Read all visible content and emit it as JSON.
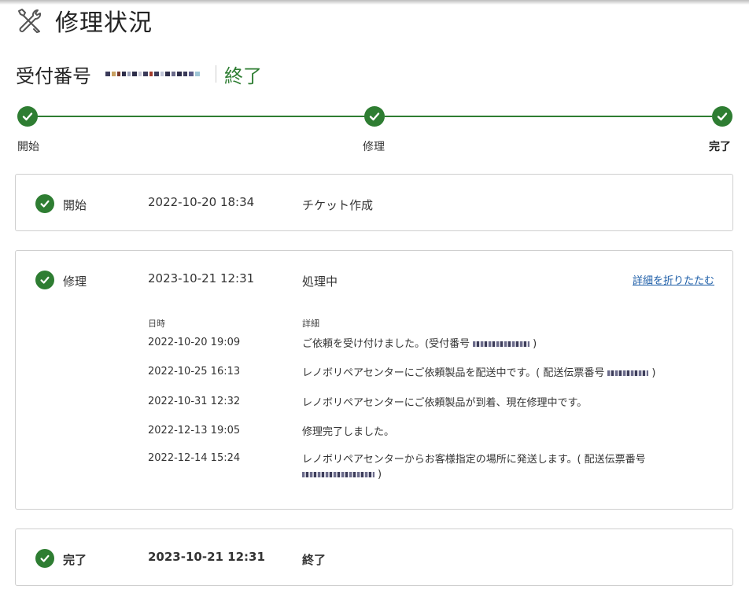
{
  "page": {
    "title": "修理状況",
    "icon": "wrench-screwdriver-icon"
  },
  "receipt": {
    "label": "受付番号",
    "status": "終了",
    "status_color": "#2e7d32"
  },
  "stepper": {
    "steps": [
      {
        "label": "開始"
      },
      {
        "label": "修理"
      },
      {
        "label": "完了"
      }
    ],
    "accent": "#2e7d32"
  },
  "timeline": {
    "start": {
      "stage": "開始",
      "date": "2022-10-20 18:34",
      "description": "チケット作成"
    },
    "repair": {
      "stage": "修理",
      "date": "2023-10-21 12:31",
      "description": "処理中",
      "collapse_label": "詳細を折りたたむ",
      "details_header": {
        "date": "日時",
        "detail": "詳細"
      },
      "details": [
        {
          "date": "2022-10-20 19:09",
          "text_before": "ご依頼を受け付けました。(受付番号",
          "text_after": ")"
        },
        {
          "date": "2022-10-25 16:13",
          "text_before": "レノボリペアセンターにご依頼製品を配送中です。( 配送伝票番号",
          "text_after": ")"
        },
        {
          "date": "2022-10-31 12:32",
          "text_before": "レノボリペアセンターにご依頼製品が到着、現在修理中です。",
          "text_after": ""
        },
        {
          "date": "2022-12-13 19:05",
          "text_before": "修理完了しました。",
          "text_after": ""
        },
        {
          "date": "2022-12-14 15:24",
          "text_before": "レノボリペアセンターからお客様指定の場所に発送します。( 配送伝票番号",
          "text_after": ")"
        }
      ]
    },
    "complete": {
      "stage": "完了",
      "date": "2023-10-21 12:31",
      "description": "終了"
    }
  }
}
